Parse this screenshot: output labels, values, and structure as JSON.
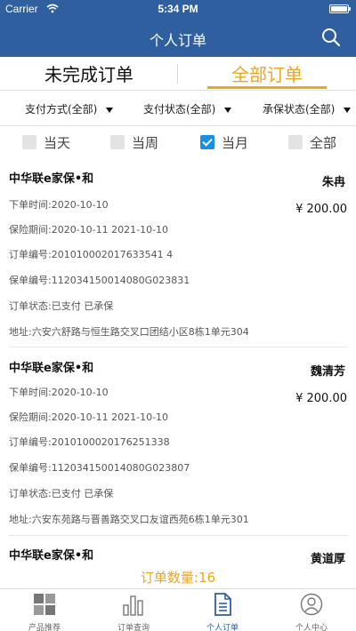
{
  "status_bar": {
    "carrier": "Carrier",
    "time": "5:34 PM"
  },
  "nav": {
    "title": "个人订单"
  },
  "tabs": [
    {
      "label": "未完成订单"
    },
    {
      "label": "全部订单"
    }
  ],
  "filters": [
    {
      "label": "支付方式(全部)"
    },
    {
      "label": "支付状态(全部)"
    },
    {
      "label": "承保状态(全部)"
    }
  ],
  "periods": [
    {
      "label": "当天",
      "checked": false
    },
    {
      "label": "当周",
      "checked": false
    },
    {
      "label": "当月",
      "checked": true
    },
    {
      "label": "全部",
      "checked": false
    }
  ],
  "orders": [
    {
      "product": "中华联e家保•和",
      "holder": "朱冉",
      "price": "¥ 200.00",
      "order_time": "下单时间:2020-10-10",
      "period": "保险期间:2020-10-11  2021-10-10",
      "order_no": "订单编号:201010002017633541 4",
      "policy_no": "保单编号:112034150014080G023831",
      "status": "订单状态:已支付  已承保",
      "address": "地址:六安六舒路与恒生路交叉口团结小区8栋1单元304"
    },
    {
      "product": "中华联e家保•和",
      "holder": "魏清芳",
      "price": "¥ 200.00",
      "order_time": "下单时间:2020-10-10",
      "period": "保险期间:2020-10-11  2021-10-10",
      "order_no": "订单编号:2010100020176251338",
      "policy_no": "保单编号:112034150014080G023807",
      "status": "订单状态:已支付  已承保",
      "address": "地址:六安东苑路与晋善路交叉口友谊西苑6栋1单元301"
    },
    {
      "product": "中华联e家保•和",
      "holder": "黄道厚"
    }
  ],
  "order_count": "订单数量:16",
  "tabbar": [
    {
      "label": "产品推荐",
      "icon": "grid-icon"
    },
    {
      "label": "订单查询",
      "icon": "bar-chart-icon"
    },
    {
      "label": "个人订单",
      "icon": "document-icon",
      "active": true
    },
    {
      "label": "个人中心",
      "icon": "person-icon"
    }
  ],
  "colors": {
    "nav": "#2f5f9e",
    "accent": "#f0a51e",
    "checkbox": "#1a8fe0"
  }
}
